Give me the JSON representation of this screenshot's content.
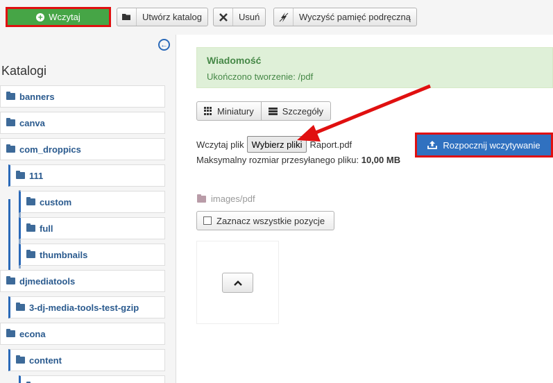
{
  "toolbar": {
    "upload_label": "Wczytaj",
    "create_folder_label": "Utwórz katalog",
    "delete_label": "Usuń",
    "clear_cache_label": "Wyczyść pamięć podręczną"
  },
  "sidebar": {
    "title": "Katalogi",
    "items": [
      {
        "label": "banners"
      },
      {
        "label": "canva"
      },
      {
        "label": "com_droppics"
      },
      {
        "label": "111"
      },
      {
        "label": "custom"
      },
      {
        "label": "full"
      },
      {
        "label": "thumbnails"
      },
      {
        "label": "djmediatools"
      },
      {
        "label": "3-dj-media-tools-test-gzip"
      },
      {
        "label": "econa"
      },
      {
        "label": "content"
      }
    ]
  },
  "message": {
    "heading": "Wiadomość",
    "body": "Ukończono tworzenie: /pdf"
  },
  "view": {
    "thumbnails_label": "Miniatury",
    "details_label": "Szczegóły"
  },
  "upload": {
    "label": "Wczytaj plik",
    "choose_button": "Wybierz pliki",
    "file_name": "Raport.pdf",
    "max_size_label": "Maksymalny rozmiar przesyłanego pliku:",
    "max_size_value": "10,00 MB",
    "start_button": "Rozpocznij wczytywanie"
  },
  "path": "images/pdf",
  "select_all_label": "Zaznacz wszystkie pozycje",
  "colors": {
    "upload_green": "#46a546",
    "highlight_red": "#e01010",
    "primary_blue": "#3071c0",
    "success_bg": "#dff0d8"
  },
  "icons": {
    "upload": "plus-circle-icon",
    "create_folder": "folder-icon",
    "delete": "x-icon",
    "clear_cache": "flash-icon",
    "collapse": "arrow-left-circle-icon",
    "thumbnails": "grid-icon",
    "details": "list-icon",
    "start_upload": "upload-icon",
    "go_up": "chevron-up-icon"
  }
}
